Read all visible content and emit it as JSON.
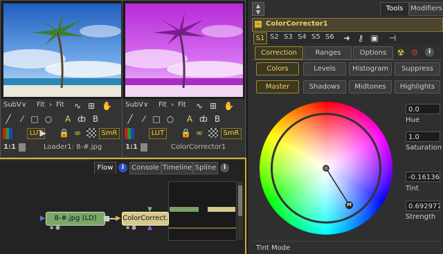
{
  "viewer_left": {
    "menu_sub": "SubV",
    "menu_fit1": "Fit",
    "menu_fit2": "Fit",
    "lut": "LUT",
    "smr": "SmR",
    "zoom": "1:1",
    "caption": "Loader1: 8-#.jpg"
  },
  "viewer_right": {
    "menu_sub": "SubV",
    "menu_fit1": "Fit",
    "menu_fit2": "Fit",
    "lut": "LUT",
    "smr": "SmR",
    "zoom": "1:1",
    "caption": "ColorCorrector1"
  },
  "flow": {
    "tabs": [
      "Flow",
      "Console",
      "Timeline",
      "Spline"
    ],
    "node_loader": "8-#.jpg  (LD)",
    "node_cc": "ColorCorrect."
  },
  "tools_panel": {
    "top_tabs": [
      "Tools",
      "Modifiers"
    ],
    "title": "ColorCorrector1",
    "slots": [
      "S1",
      "S2",
      "S3",
      "S4",
      "S5",
      "S6"
    ],
    "tabs": [
      "Correction",
      "Ranges",
      "Options"
    ],
    "row1": [
      "Colors",
      "Levels",
      "Histogram",
      "Suppress"
    ],
    "row2": [
      "Master",
      "Shadows",
      "Midtones",
      "Highlights"
    ],
    "hue_value": "0.0",
    "hue_label": "Hue",
    "sat_value": "1.0",
    "sat_label": "Saturation",
    "tint_value": "-0.16136(",
    "tint_label": "Tint",
    "strength_value": "0.692977",
    "strength_label": "Strength",
    "wheel_marker": "M",
    "bottom_label": "Tint Mode"
  }
}
